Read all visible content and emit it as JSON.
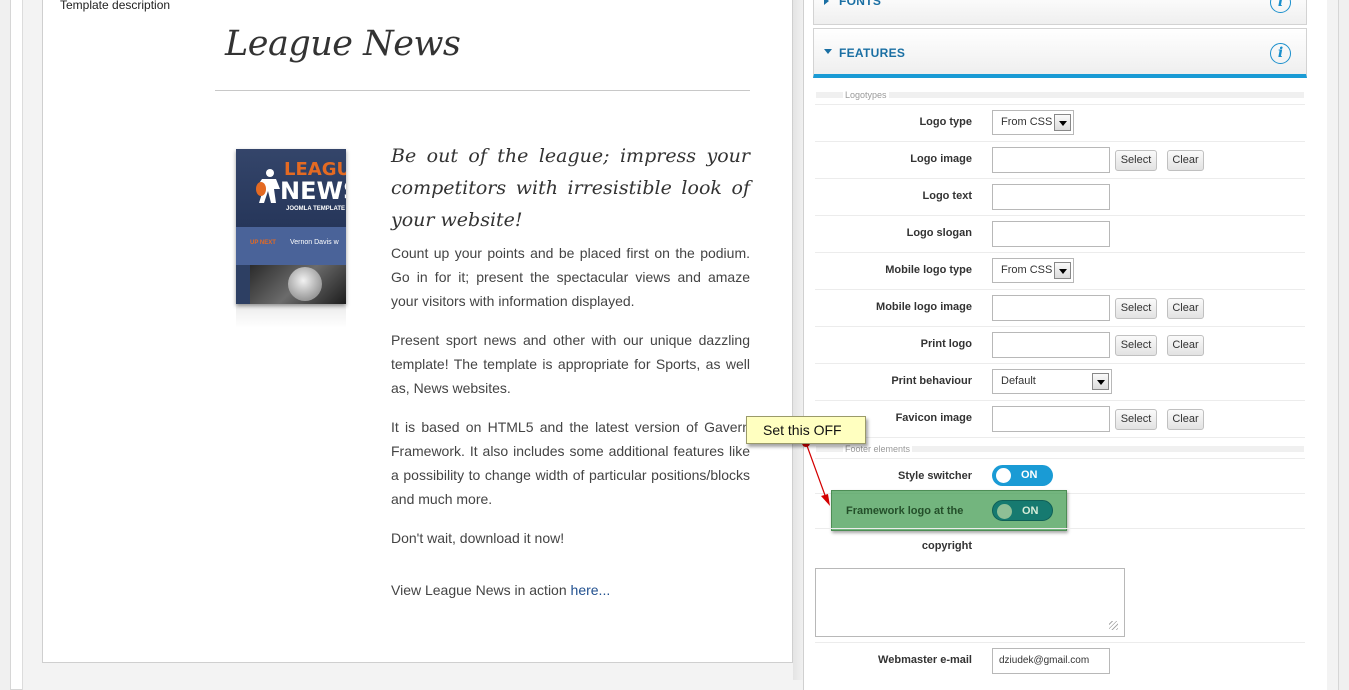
{
  "left": {
    "section_caption": "Template description",
    "title": "League News",
    "thumbnail": {
      "logo_line1": "LEAGUE",
      "logo_line2": "NEWS",
      "logo_line3": "JOOMLA TEMPLATE",
      "up_next": "UP NEXT",
      "ticker": "Vernon Davis w"
    },
    "lead": "Be out of the league; impress your competitors with irresistible look of your website!",
    "paragraphs": [
      "Count up your points and be placed first on the podium. Go in for it; present the spectacular views and amaze your visitors with information displayed.",
      "Present sport news and other with our unique dazzling template! The template is appropriate for Sports, as well as, News websites.",
      "It is based on HTML5 and the latest version of Gavern Framework. It also includes some additional features like a possibility to change width of particular positions/blocks and much more.",
      "Don't wait, download it now!"
    ],
    "action_prefix": "View League News in action ",
    "action_link": "here..."
  },
  "accordion": {
    "fonts_label": "FONTS",
    "features_label": "FEATURES",
    "info_glyph": "i"
  },
  "features": {
    "logotypes_section": "Logotypes",
    "footer_section": "Footer elements",
    "select_label": "Select",
    "clear_label": "Clear",
    "logo_type": {
      "label": "Logo type",
      "value": "From CSS"
    },
    "logo_image": {
      "label": "Logo image",
      "value": ""
    },
    "logo_text": {
      "label": "Logo text",
      "value": ""
    },
    "logo_slogan": {
      "label": "Logo slogan",
      "value": ""
    },
    "mobile_logo_type": {
      "label": "Mobile logo type",
      "value": "From CSS"
    },
    "mobile_logo_image": {
      "label": "Mobile logo image",
      "value": ""
    },
    "print_logo": {
      "label": "Print logo",
      "value": ""
    },
    "print_behaviour": {
      "label": "Print behaviour",
      "value": "Default"
    },
    "favicon_image": {
      "label": "Favicon image",
      "value": ""
    },
    "style_switcher": {
      "label": "Style switcher",
      "value": "ON"
    },
    "framework_logo": {
      "label_line1": "Framework logo at the",
      "label_line2": "copyright",
      "value": "ON"
    },
    "webmaster_email": {
      "label": "Webmaster e-mail",
      "value": "dziudek@gmail.com"
    }
  },
  "annotation": {
    "callout_text": "Set this OFF",
    "accent_color": "#d40000"
  },
  "colors": {
    "accent_blue": "#1a9bd5",
    "highlight_green": "#4ca05a",
    "callout_yellow": "#ffffc0"
  }
}
